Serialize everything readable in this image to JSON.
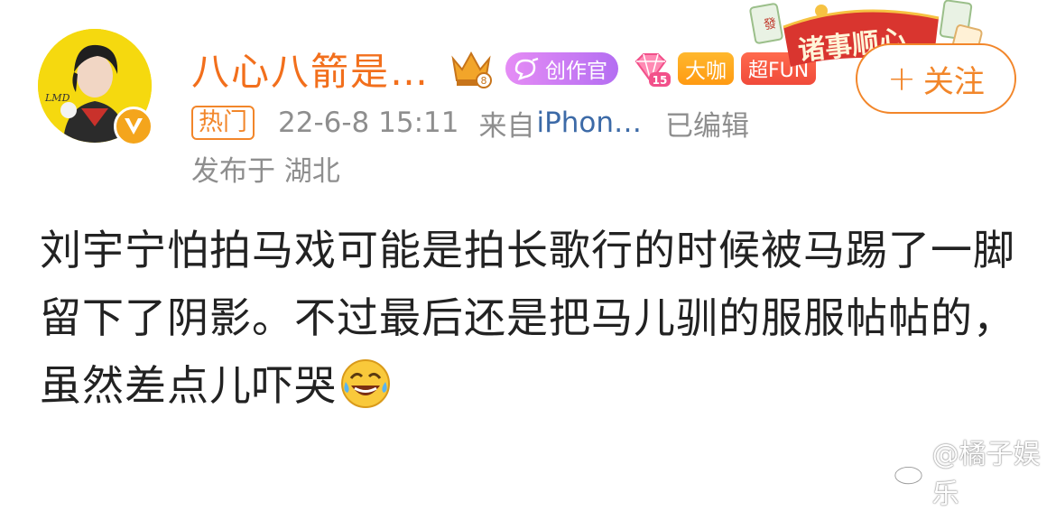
{
  "user": {
    "name": "八心八箭是…",
    "badges": {
      "creator": "创作官",
      "level_number": "15",
      "level_crown_number": "8",
      "dk": "大咖",
      "fun": "超FUN"
    }
  },
  "banner": {
    "text": "诸事顺心"
  },
  "follow": {
    "plus": "+",
    "label": "关注"
  },
  "meta": {
    "hot_tag": "热门",
    "datetime": "22-6-8 15:11",
    "source_prefix": "来自",
    "source_device": "iPhon…",
    "edited": "已编辑",
    "location": "发布于 湖北"
  },
  "post": {
    "text": "刘宇宁怕拍马戏可能是拍长歌行的时候被马踢了一脚留下了阴影。不过最后还是把马儿驯的服服帖帖的，虽然差点儿吓哭",
    "emoji": "laugh-cry-emoji"
  },
  "watermark": {
    "text": "@橘子娱乐"
  },
  "colors": {
    "accent": "#f2862a",
    "username": "#f26f1c",
    "link": "#3c6aa7",
    "meta": "#8e8e8e",
    "body": "#222222"
  }
}
